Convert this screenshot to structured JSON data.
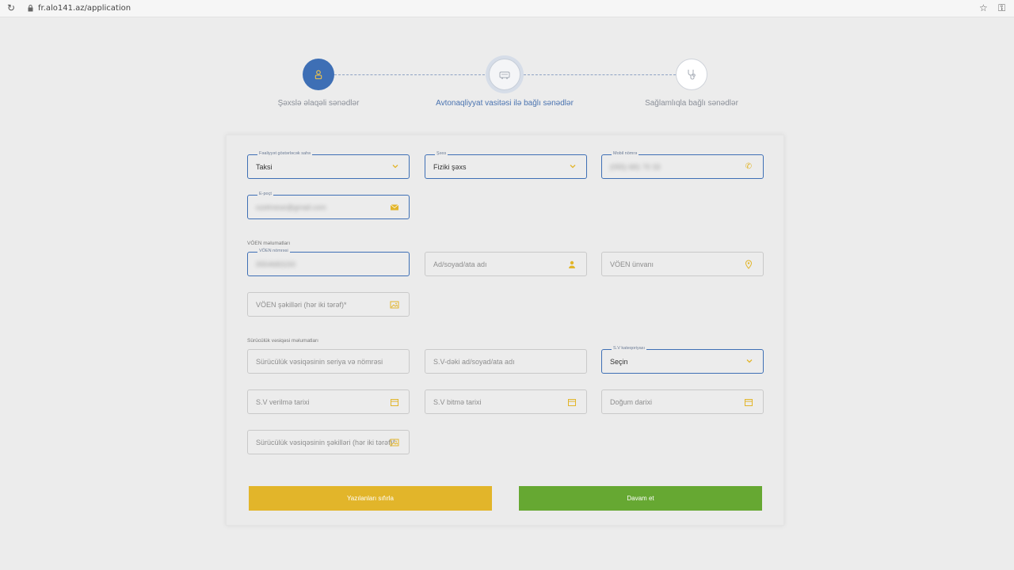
{
  "browser": {
    "url": "fr.alo141.az/application",
    "icons": [
      "reload-icon",
      "lock-icon",
      "star-icon",
      "key-icon"
    ]
  },
  "stepper": {
    "steps": [
      {
        "label": "Şəxslə əlaqəli sənədlər",
        "icon": "person-icon",
        "state": "completed"
      },
      {
        "label": "Avtonaqliyyat vasitəsi ilə bağlı sənədlər",
        "icon": "car-icon",
        "state": "current"
      },
      {
        "label": "Sağlamlıqla bağlı sənədlər",
        "icon": "stethoscope-icon",
        "state": "pending"
      }
    ]
  },
  "form": {
    "activity": {
      "label": "Fəaliyyət göstərləcək sahə",
      "value": "Taksi"
    },
    "person_type": {
      "label": "Şəxs",
      "value": "Fiziki şəxs"
    },
    "mobile": {
      "label": "Mobil nömrə",
      "value": "(055) 681 70 33"
    },
    "email": {
      "label": "E-poçt",
      "value": "ozelmese@gmail.com"
    },
    "voen_section": "VÖEN məlumatları",
    "voen_number": {
      "label": "VÖEN nömrəsi",
      "value": "0554683150"
    },
    "voen_name": {
      "placeholder": "Ad/soyad/ata adı"
    },
    "voen_address": {
      "placeholder": "VÖEN ünvanı"
    },
    "voen_photos": {
      "placeholder": "VÖEN şəkilləri (hər iki tərəf)*"
    },
    "license_section": "Sürücülük vəsiqəsi məlumatları",
    "license_number": {
      "placeholder": "Sürücülük vəsiqəsinin seriya və nömrəsi"
    },
    "license_name": {
      "placeholder": "S.V-dəki ad/soyad/ata adı"
    },
    "license_category": {
      "label": "S.V kateqoriyası",
      "value": "Seçin"
    },
    "issue_date": {
      "placeholder": "S.V verilmə tarixi"
    },
    "expiry_date": {
      "placeholder": "S.V bitmə tarixi"
    },
    "birth_date": {
      "placeholder": "Doğum darixi"
    },
    "license_photos": {
      "placeholder": "Sürücülük vəsiqəsinin şəkilləri (hər iki tərəf)*"
    }
  },
  "buttons": {
    "reset": "Yazılanları sıfırla",
    "next": "Davam et"
  },
  "colors": {
    "accent_blue": "#3e6fb5",
    "accent_yellow": "#e2b52a",
    "accent_green": "#66a832"
  }
}
